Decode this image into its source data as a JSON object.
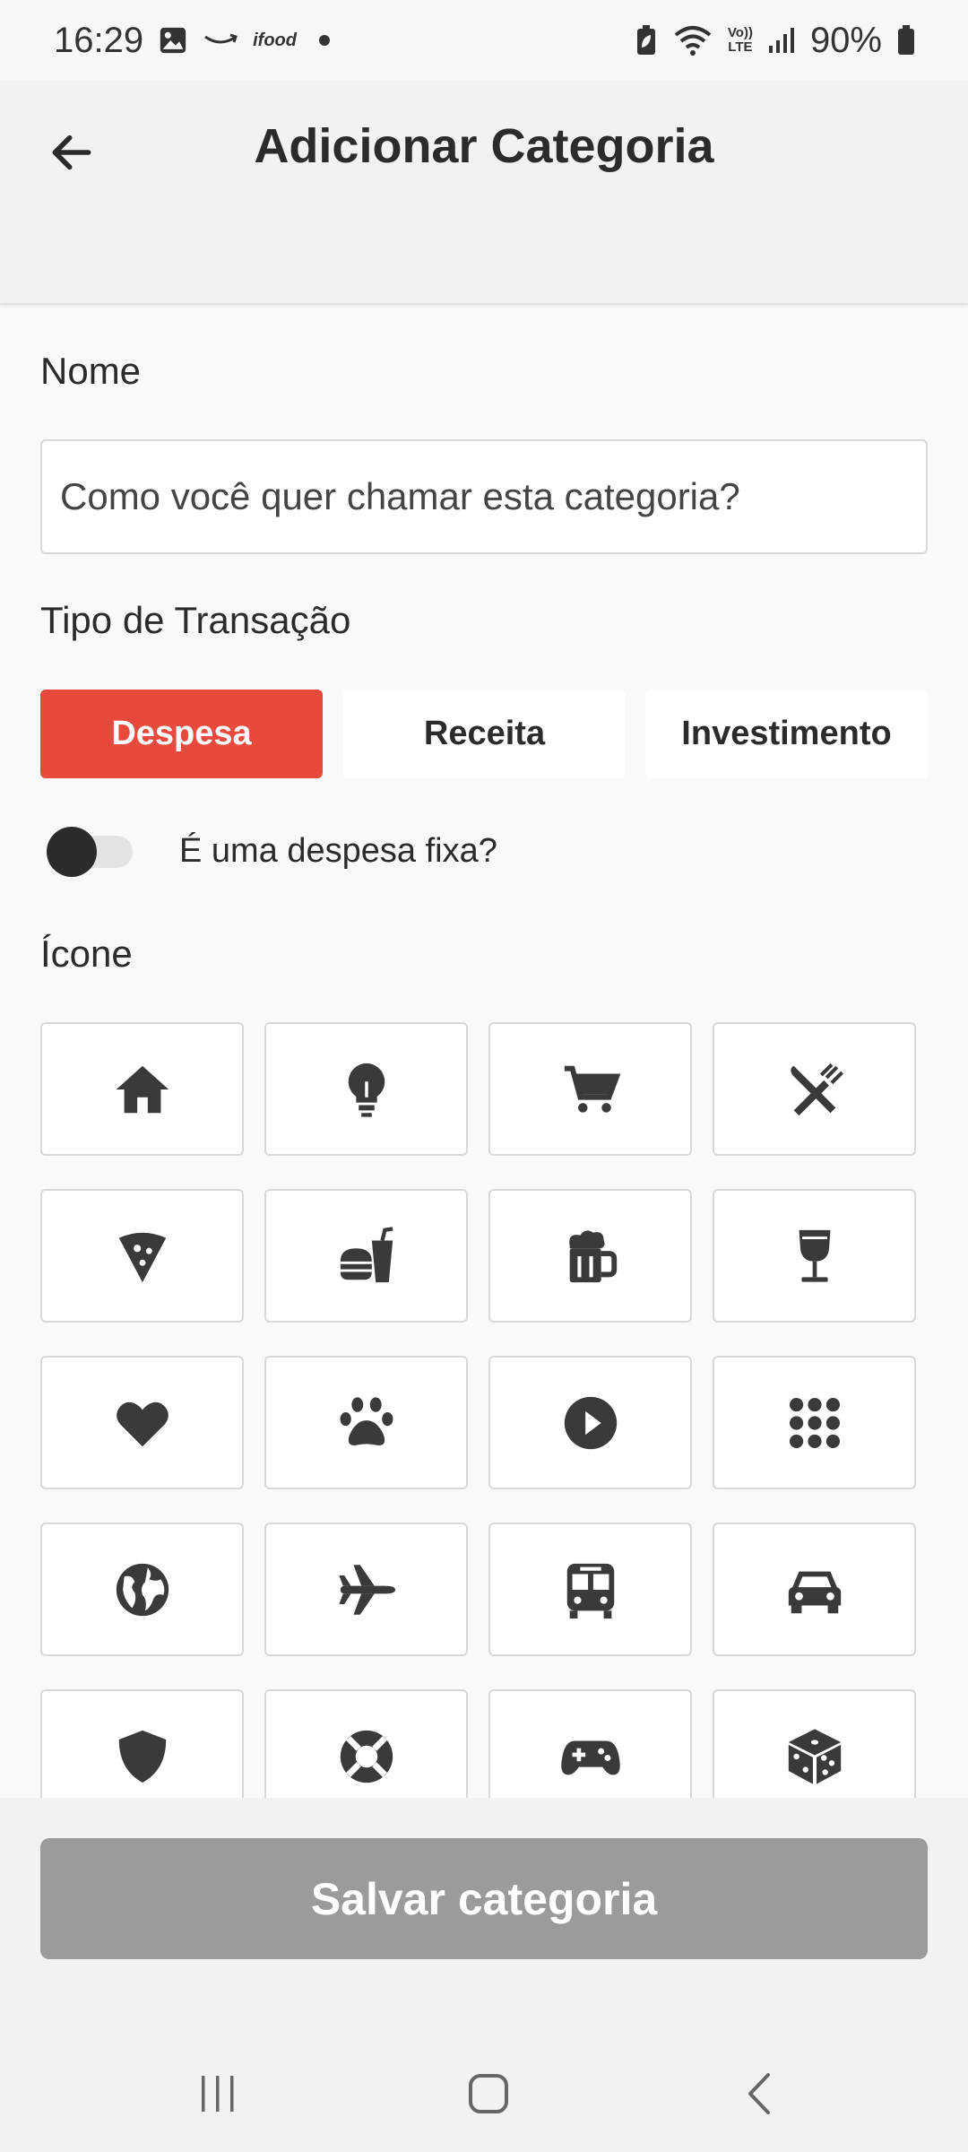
{
  "status_bar": {
    "time": "16:29",
    "battery": "90%",
    "left_icons": [
      "image-icon",
      "amazon-icon",
      "ifood-icon",
      "dot-icon"
    ],
    "right_icons": [
      "battery-saver-icon",
      "wifi-icon",
      "volte-icon",
      "signal-icon",
      "battery-icon"
    ],
    "ifood_text": "ifood",
    "volte_text_top": "Vo))",
    "volte_text_bottom": "LTE"
  },
  "header": {
    "title": "Adicionar Categoria",
    "back_icon": "arrow-left-icon"
  },
  "form": {
    "name_label": "Nome",
    "name_value": "",
    "name_placeholder": "Como você quer chamar esta categoria?",
    "type_label": "Tipo de Transação",
    "types": [
      {
        "label": "Despesa",
        "active": true
      },
      {
        "label": "Receita",
        "active": false
      },
      {
        "label": "Investimento",
        "active": false
      }
    ],
    "fixed_toggle_label": "É uma despesa fixa?",
    "fixed_toggle_on": false,
    "icon_label": "Ícone",
    "icons": [
      "home-icon",
      "lightbulb-icon",
      "cart-icon",
      "utensils-icon",
      "pizza-icon",
      "fastfood-icon",
      "beer-icon",
      "wine-glass-icon",
      "heart-icon",
      "paw-icon",
      "play-circle-icon",
      "grid-dots-icon",
      "globe-icon",
      "airplane-icon",
      "bus-icon",
      "car-icon",
      "shield-icon",
      "life-ring-icon",
      "gamepad-icon",
      "dice-icon"
    ]
  },
  "footer": {
    "save_label": "Salvar categoria"
  },
  "nav": {
    "icons": [
      "recent-apps-icon",
      "home-nav-icon",
      "back-nav-icon"
    ]
  },
  "colors": {
    "accent": "#e8493d",
    "icon": "#3a3a3a",
    "disabled_button": "#9b9b9b"
  }
}
